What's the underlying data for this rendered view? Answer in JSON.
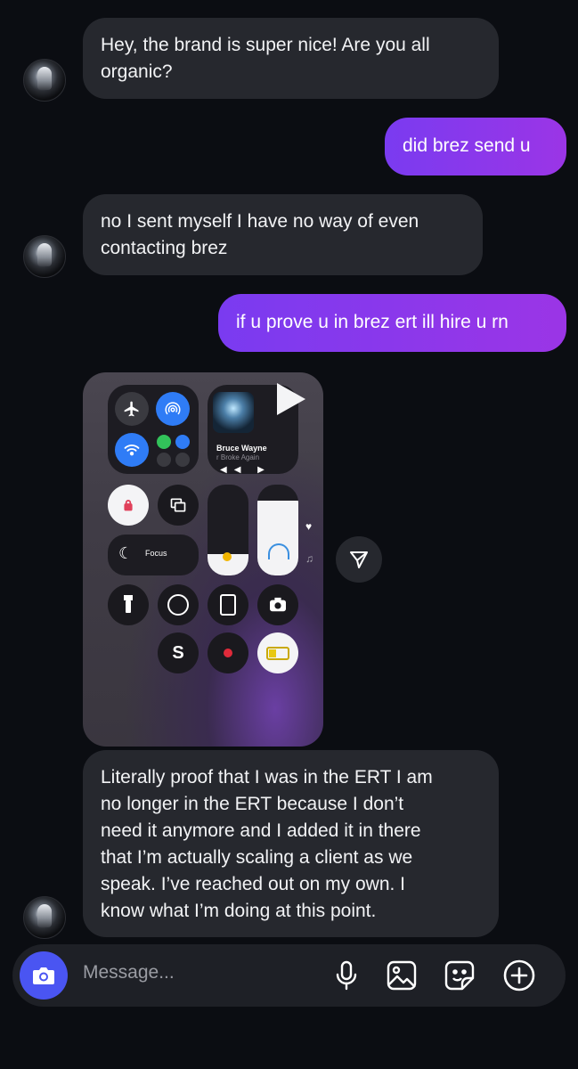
{
  "messages": [
    {
      "type": "incoming",
      "lines": [
        "Hey, the brand is super nice! Are you all",
        "organic?"
      ]
    },
    {
      "type": "outgoing",
      "text": "did brez send u"
    },
    {
      "type": "incoming",
      "lines": [
        "no I sent myself I have no way of even",
        "contacting brez"
      ]
    },
    {
      "type": "outgoing",
      "text": "if u prove u in brez ert ill hire u rn"
    },
    {
      "type": "incoming",
      "lines": [
        "Literally proof that I was in the ERT I am",
        "no longer in the ERT because I don’t",
        "need it anymore and I added it in there",
        "that I’m actually scaling a client as we",
        "speak. I’ve reached out on my own. I",
        "know what I’m doing at this point."
      ]
    }
  ],
  "media": {
    "now_playing_title": "Bruce Wayne",
    "now_playing_subtitle": "r Broke Again",
    "focus_label": "Focus"
  },
  "composer": {
    "placeholder": "Message..."
  },
  "colors": {
    "background": "#0b0d12",
    "incoming_bubble": "#26282e",
    "outgoing_bubble": "#8a2be2",
    "camera_button": "#4a55f2"
  },
  "icons": [
    "camera-icon",
    "microphone-icon",
    "gallery-icon",
    "sticker-icon",
    "add-icon",
    "share-icon",
    "play-icon"
  ]
}
